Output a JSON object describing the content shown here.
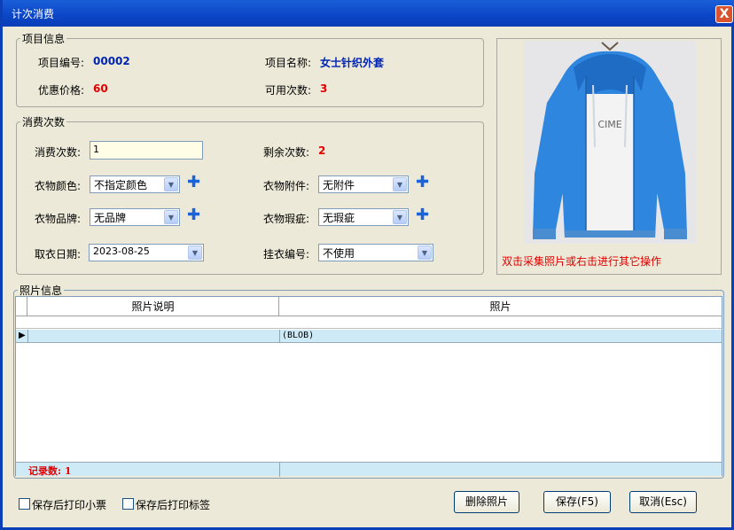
{
  "window": {
    "title": "计次消费",
    "close_label": "X"
  },
  "project_info": {
    "legend": "项目信息",
    "code_label": "项目编号:",
    "code_value": "00002",
    "name_label": "项目名称:",
    "name_value": "女士针织外套",
    "price_label": "优惠价格:",
    "price_value": "60",
    "available_label": "可用次数:",
    "available_value": "3"
  },
  "consume": {
    "legend": "消费次数",
    "count_label": "消费次数:",
    "count_value": "1",
    "remaining_label": "剩余次数:",
    "remaining_value": "2",
    "color_label": "衣物颜色:",
    "color_value": "不指定颜色",
    "accessory_label": "衣物附件:",
    "accessory_value": "无附件",
    "brand_label": "衣物品牌:",
    "brand_value": "无品牌",
    "defect_label": "衣物瑕疵:",
    "defect_value": "无瑕疵",
    "pickup_label": "取衣日期:",
    "pickup_value": "2023-08-25",
    "hanger_label": "挂衣编号:",
    "hanger_value": "不使用"
  },
  "photo_panel": {
    "hint": "双击采集照片或右击进行其它操作"
  },
  "photo_grid": {
    "legend": "照片信息",
    "columns": [
      "照片说明",
      "照片"
    ],
    "rows": [
      {
        "desc": "",
        "photo": "(BLOB)"
      }
    ],
    "footer": "记录数: 1"
  },
  "options": {
    "print_receipt": "保存后打印小票",
    "print_label": "保存后打印标签"
  },
  "buttons": {
    "delete_photo": "删除照片",
    "save": "保存(F5)",
    "cancel": "取消(Esc)"
  }
}
